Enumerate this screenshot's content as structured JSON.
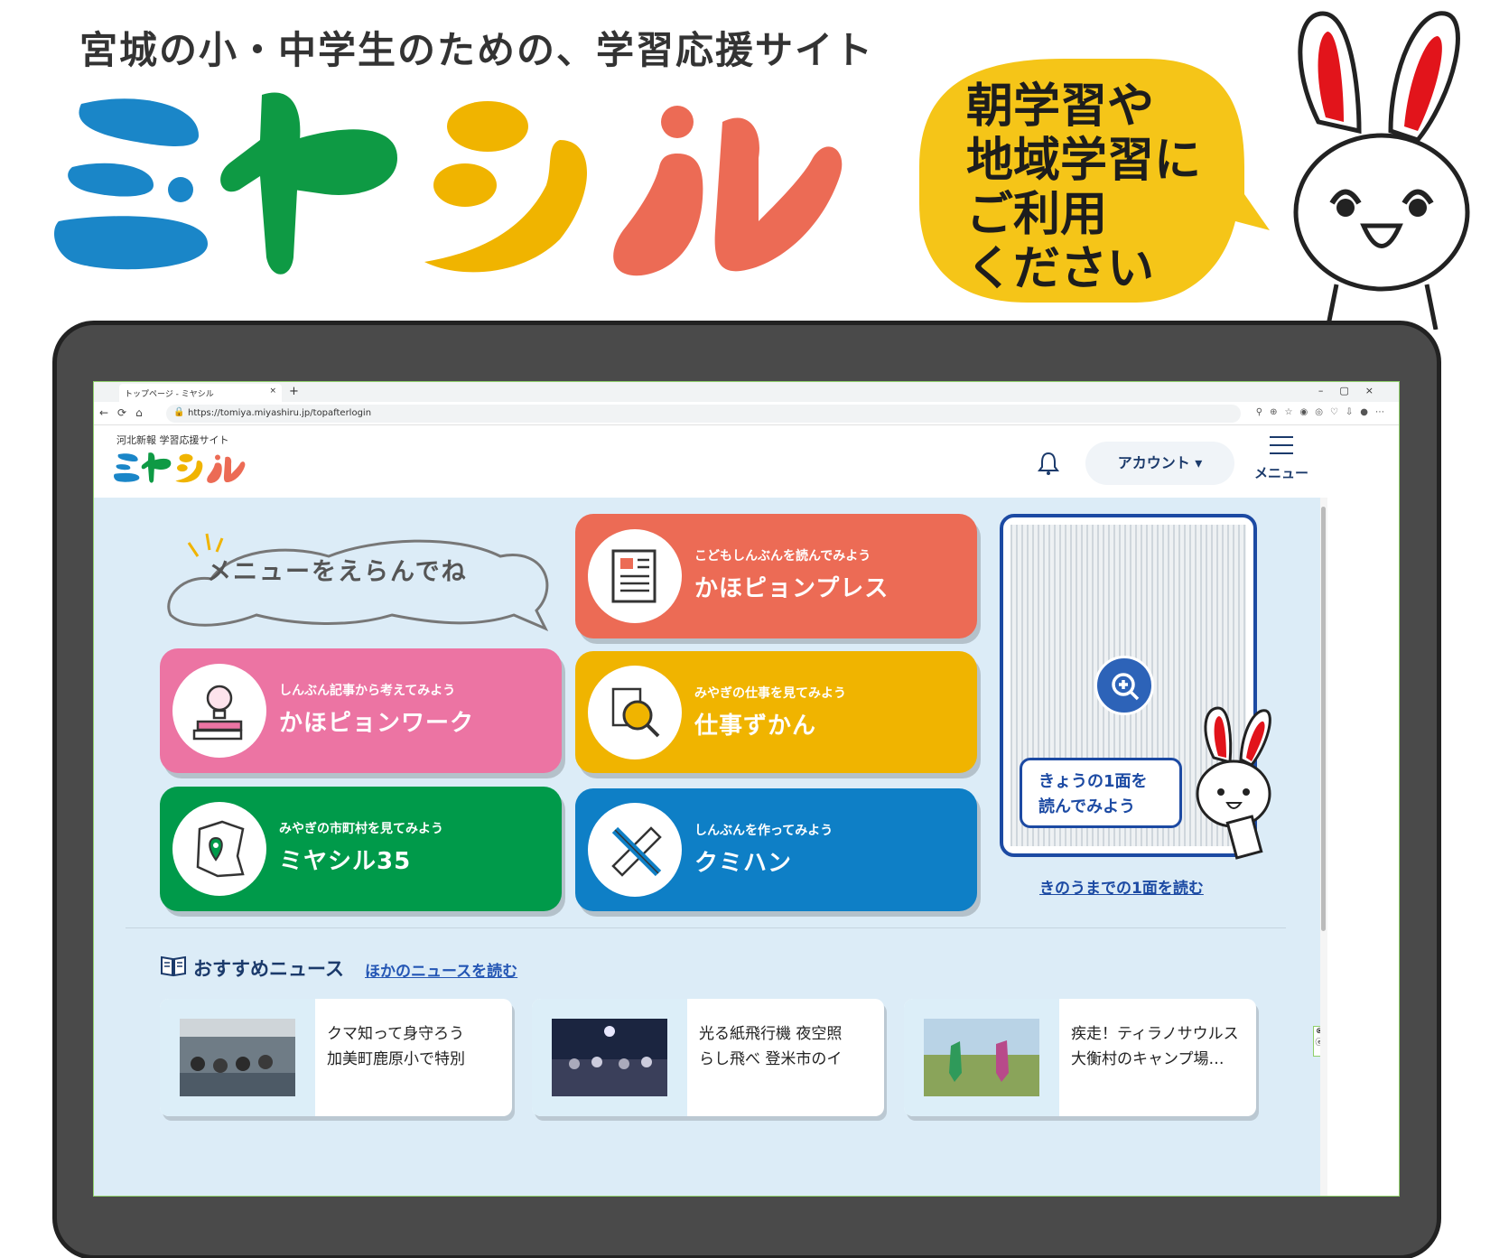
{
  "poster": {
    "tagline": "宮城の小・中学生のための、学習応援サイト",
    "logo_text": "ミヤシル",
    "bubble_lines": [
      "朝学習や",
      "地域学習に",
      "ご利用",
      "ください"
    ]
  },
  "browser": {
    "tab_title": "トップページ - ミヤシル",
    "tab_close": "×",
    "new_tab": "+",
    "window_controls": "–▢×",
    "nav_buttons": "←⟳⌂",
    "url": "https://tomiya.miyashiru.jp/topafterlogin",
    "tools": "⚲⊕☆◉◎♡⇩●⋯"
  },
  "site": {
    "subtitle": "河北新報 学習応援サイト",
    "logo_text": "ミヤシル",
    "account_label": "アカウント ▾",
    "menu_label": "メニュー"
  },
  "main": {
    "cloud_text": "メニューをえらんでね",
    "cards": [
      {
        "sub": "こどもしんぶんを読んでみよう",
        "title": "かほピョンプレス",
        "color": "#ec6b55"
      },
      {
        "sub": "しんぶん記事から考えてみよう",
        "title": "かほピョンワーク",
        "color": "#ec74a3"
      },
      {
        "sub": "みやぎの仕事を見てみよう",
        "title": "仕事ずかん",
        "color": "#f0b400"
      },
      {
        "sub": "みやぎの市町村を見てみよう",
        "title": "ミヤシル35",
        "color": "#009a4a"
      },
      {
        "sub": "しんぶんを作ってみよう",
        "title": "クミハン",
        "color": "#0e7fc6"
      }
    ],
    "front_page": {
      "bubble_line1": "きょうの1面を",
      "bubble_line2": "読んでみよう",
      "link": "きのうまでの1面を読む"
    }
  },
  "recommended": {
    "title": "おすすめニュース",
    "link": "ほかのニュースを読む",
    "items": [
      {
        "line1": "クマ知って身守ろう",
        "line2": "加美町鹿原小で特別"
      },
      {
        "line1": "光る紙飛行機 夜空照",
        "line2": "らし飛べ 登米市のイ"
      },
      {
        "line1": "疾走！ティラノサウルス",
        "line2": "大衡村のキャンプ場…"
      }
    ]
  },
  "colors": {
    "logo_blue": "#1a86c8",
    "logo_green": "#0e9a44",
    "logo_yellow": "#f0b400",
    "logo_red": "#ec6b55",
    "bubble_yellow": "#f5c518",
    "navy": "#1b3a6b",
    "content_bg": "#dcecf7"
  }
}
